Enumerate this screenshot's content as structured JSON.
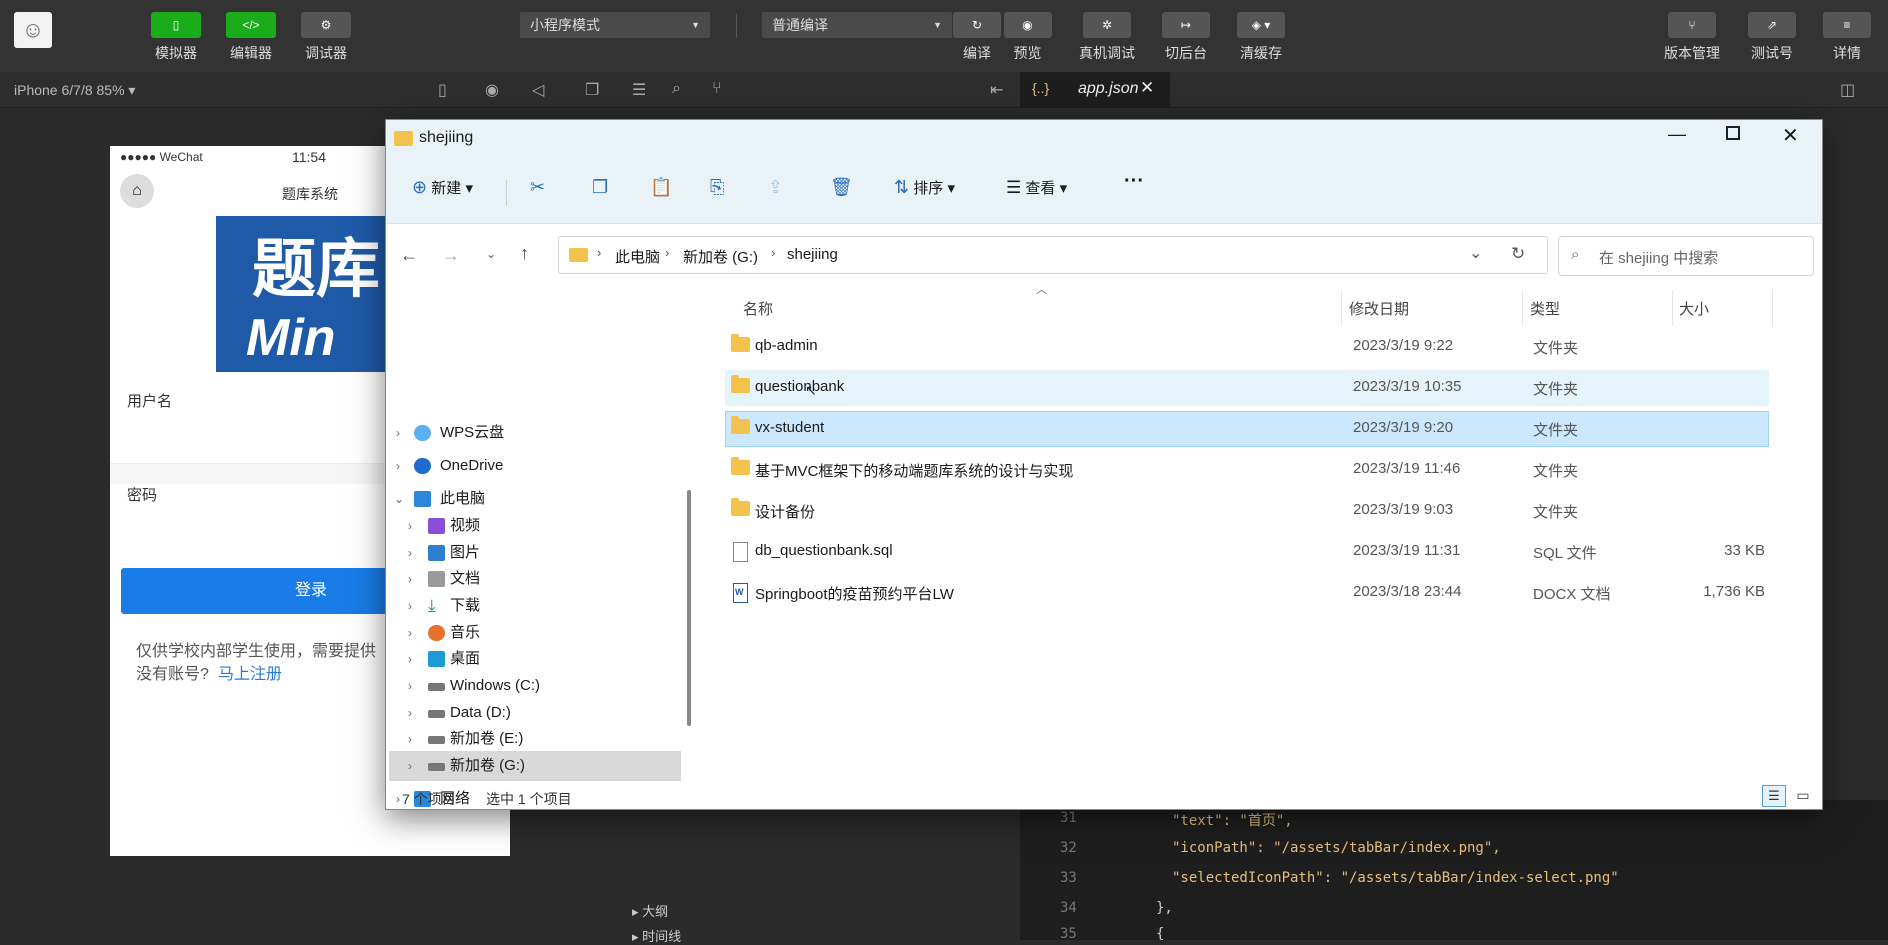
{
  "toolbar": {
    "left_buttons": [
      {
        "label": "模拟器",
        "icon": "phone-icon"
      },
      {
        "label": "编辑器",
        "icon": "code-icon"
      },
      {
        "label": "调试器",
        "icon": "sliders-icon"
      }
    ],
    "mode_select": "小程序模式",
    "compile_select": "普通编译",
    "mid_buttons": [
      {
        "label": "编译",
        "icon": "refresh-icon"
      },
      {
        "label": "预览",
        "icon": "eye-icon"
      },
      {
        "label": "真机调试",
        "icon": "bug-icon"
      },
      {
        "label": "切后台",
        "icon": "arrow-right-bar-icon"
      },
      {
        "label": "清缓存",
        "icon": "layers-icon"
      }
    ],
    "right_buttons": [
      {
        "label": "版本管理",
        "icon": "branch-icon"
      },
      {
        "label": "测试号",
        "icon": "external-icon"
      },
      {
        "label": "详情",
        "icon": "menu-icon"
      }
    ]
  },
  "subbar": {
    "device": "iPhone 6/7/8 85% ▾",
    "tab_label": "app.json"
  },
  "simulator": {
    "signal": "●●●●● WeChat",
    "time": "11:54",
    "page_title": "题库系统",
    "banner_line1": "题库",
    "banner_line2": "Min",
    "username_label": "用户名",
    "password_label": "密码",
    "login_button": "登录",
    "notice": "仅供学校内部学生使用，需要提供",
    "register_prefix": "没有账号?",
    "register_link": "马上注册"
  },
  "editor": {
    "lines": [
      {
        "no": "31",
        "text": "\"text\": \"首页\","
      },
      {
        "no": "32",
        "text": "\"iconPath\": \"/assets/tabBar/index.png\","
      },
      {
        "no": "33",
        "text": "\"selectedIconPath\": \"/assets/tabBar/index-select.png\""
      },
      {
        "no": "34",
        "text": "},"
      },
      {
        "no": "35",
        "text": "{"
      }
    ],
    "outline": "大纲",
    "timeline": "时间线"
  },
  "explorer": {
    "title": "shejiing",
    "commands": {
      "new": "新建",
      "sort": "排序",
      "view": "查看",
      "more": "···"
    },
    "breadcrumb": [
      "此电脑",
      "新加卷 (G:)",
      "shejiing"
    ],
    "search_placeholder": "在 shejiing 中搜索",
    "nav": [
      {
        "label": "WPS云盘",
        "indent": 0
      },
      {
        "label": "OneDrive",
        "indent": 0
      },
      {
        "label": "此电脑",
        "indent": 0,
        "expanded": true
      },
      {
        "label": "视频",
        "indent": 1
      },
      {
        "label": "图片",
        "indent": 1
      },
      {
        "label": "文档",
        "indent": 1
      },
      {
        "label": "下载",
        "indent": 1
      },
      {
        "label": "音乐",
        "indent": 1
      },
      {
        "label": "桌面",
        "indent": 1
      },
      {
        "label": "Windows (C:)",
        "indent": 1
      },
      {
        "label": "Data (D:)",
        "indent": 1
      },
      {
        "label": "新加卷 (E:)",
        "indent": 1
      },
      {
        "label": "新加卷 (G:)",
        "indent": 1,
        "selected": true
      },
      {
        "label": "网络",
        "indent": 0
      }
    ],
    "columns": {
      "name": "名称",
      "date": "修改日期",
      "type": "类型",
      "size": "大小"
    },
    "files": [
      {
        "name": "qb-admin",
        "date": "2023/3/19 9:22",
        "type": "文件夹",
        "size": "",
        "kind": "folder"
      },
      {
        "name": "questionbank",
        "date": "2023/3/19 10:35",
        "type": "文件夹",
        "size": "",
        "kind": "folder",
        "state": "hover"
      },
      {
        "name": "vx-student",
        "date": "2023/3/19 9:20",
        "type": "文件夹",
        "size": "",
        "kind": "folder",
        "state": "selected"
      },
      {
        "name": "基于MVC框架下的移动端题库系统的设计与实现",
        "date": "2023/3/19 11:46",
        "type": "文件夹",
        "size": "",
        "kind": "folder"
      },
      {
        "name": "设计备份",
        "date": "2023/3/19 9:03",
        "type": "文件夹",
        "size": "",
        "kind": "folder"
      },
      {
        "name": "db_questionbank.sql",
        "date": "2023/3/19 11:31",
        "type": "SQL 文件",
        "size": "33 KB",
        "kind": "file"
      },
      {
        "name": "Springboot的疫苗预约平台LW",
        "date": "2023/3/18 23:44",
        "type": "DOCX 文档",
        "size": "1,736 KB",
        "kind": "docx"
      }
    ],
    "status": {
      "count": "7 个项目",
      "selected": "选中 1 个项目"
    }
  }
}
